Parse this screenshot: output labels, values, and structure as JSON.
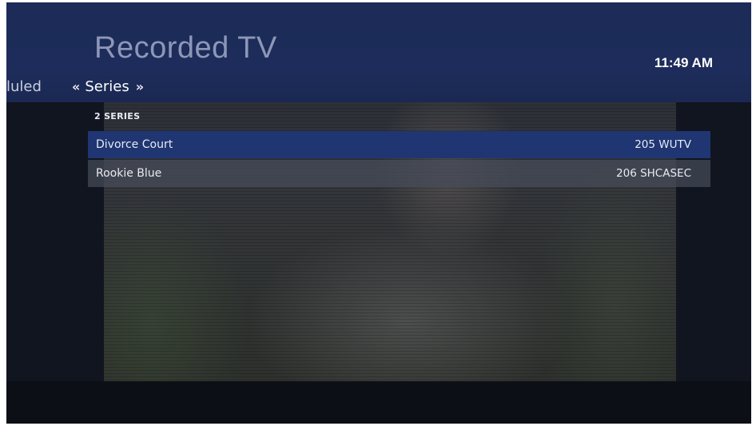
{
  "header": {
    "title": "Recorded TV",
    "clock": "11:49 AM"
  },
  "pivot": {
    "previous_label": "luled",
    "current_label": "Series",
    "left_arrow": "«",
    "right_arrow": "»"
  },
  "list": {
    "count_label": "2 SERIES",
    "items": [
      {
        "name": "Divorce Court",
        "channel": "205 WUTV",
        "selected": true
      },
      {
        "name": "Rookie Blue",
        "channel": "206 SHCASEC",
        "selected": false
      }
    ]
  },
  "colors": {
    "header_band": "#1d2c5a",
    "selected_row": "#1f3673",
    "title_text": "#8e97b8"
  }
}
